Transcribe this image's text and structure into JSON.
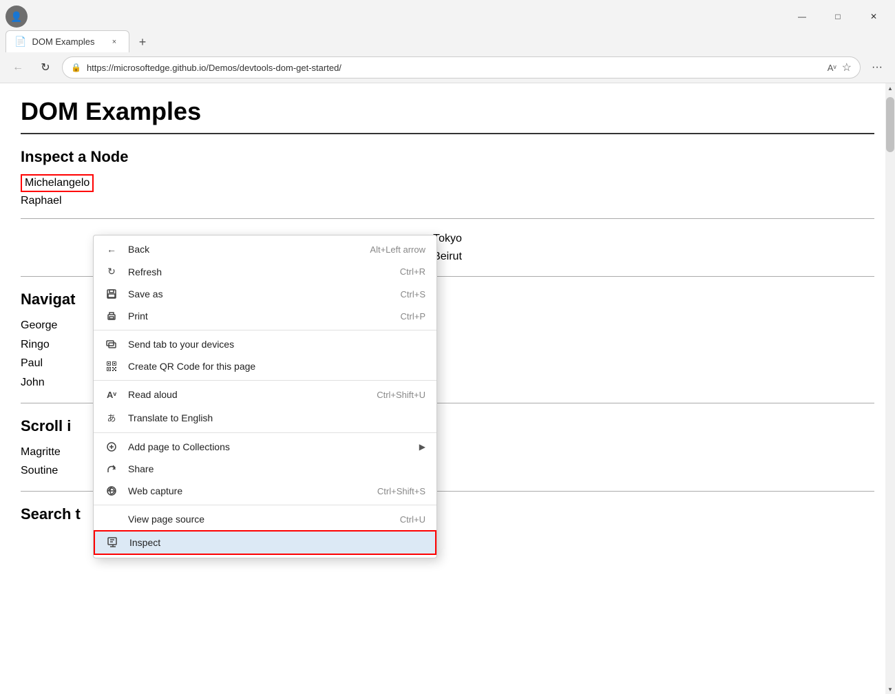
{
  "browser": {
    "profile_icon": "👤",
    "tab": {
      "icon": "📄",
      "title": "DOM Examples",
      "close": "×"
    },
    "new_tab": "+",
    "address": {
      "back_label": "←",
      "refresh_label": "↻",
      "lock_icon": "🔒",
      "url": "https://microsoftedge.github.io/Demos/devtools-dom-get-started/",
      "read_aloud_icon": "A",
      "favorites_icon": "☆",
      "menu_icon": "···"
    },
    "window_controls": {
      "minimize": "—",
      "maximize": "□",
      "close": "✕"
    }
  },
  "page": {
    "title": "DOM Examples",
    "sections": [
      {
        "id": "inspect",
        "heading": "Inspect a Node",
        "items": [
          {
            "text": "Michelangelo",
            "highlighted": true
          },
          {
            "text": "Raphael",
            "highlighted": false
          }
        ]
      },
      {
        "id": "cities",
        "items": [
          {
            "text": "Tokyo"
          },
          {
            "text": "Beirut"
          }
        ]
      },
      {
        "id": "navigate",
        "heading": "Navigat",
        "items": [
          {
            "text": "George"
          },
          {
            "text": "Ringo"
          },
          {
            "text": "Paul"
          },
          {
            "text": "John"
          }
        ]
      },
      {
        "id": "scroll",
        "heading": "Scroll i",
        "items": [
          {
            "text": "Magritte"
          },
          {
            "text": "Soutine"
          }
        ]
      },
      {
        "id": "search",
        "heading": "Search t"
      }
    ]
  },
  "context_menu": {
    "items": [
      {
        "id": "back",
        "icon": "←",
        "label": "Back",
        "shortcut": "Alt+Left arrow",
        "has_arrow": false
      },
      {
        "id": "refresh",
        "icon": "↻",
        "label": "Refresh",
        "shortcut": "Ctrl+R",
        "has_arrow": false
      },
      {
        "id": "save_as",
        "icon": "💾",
        "label": "Save as",
        "shortcut": "Ctrl+S",
        "has_arrow": false
      },
      {
        "id": "print",
        "icon": "🖨",
        "label": "Print",
        "shortcut": "Ctrl+P",
        "has_arrow": false
      },
      {
        "id": "send_tab",
        "icon": "📱",
        "label": "Send tab to your devices",
        "shortcut": "",
        "has_arrow": false
      },
      {
        "id": "qr_code",
        "icon": "⊞",
        "label": "Create QR Code for this page",
        "shortcut": "",
        "has_arrow": false
      },
      {
        "id": "read_aloud",
        "icon": "Aᵛ",
        "label": "Read aloud",
        "shortcut": "Ctrl+Shift+U",
        "has_arrow": false
      },
      {
        "id": "translate",
        "icon": "あ",
        "label": "Translate to English",
        "shortcut": "",
        "has_arrow": false
      },
      {
        "id": "collections",
        "icon": "⊕",
        "label": "Add page to Collections",
        "shortcut": "",
        "has_arrow": true
      },
      {
        "id": "share",
        "icon": "⤴",
        "label": "Share",
        "shortcut": "",
        "has_arrow": false
      },
      {
        "id": "web_capture",
        "icon": "📷",
        "label": "Web capture",
        "shortcut": "Ctrl+Shift+S",
        "has_arrow": false
      },
      {
        "id": "view_source",
        "icon": "",
        "label": "View page source",
        "shortcut": "Ctrl+U",
        "has_arrow": false
      },
      {
        "id": "inspect",
        "icon": "🔍",
        "label": "Inspect",
        "shortcut": "",
        "has_arrow": false,
        "highlighted": true
      }
    ]
  }
}
